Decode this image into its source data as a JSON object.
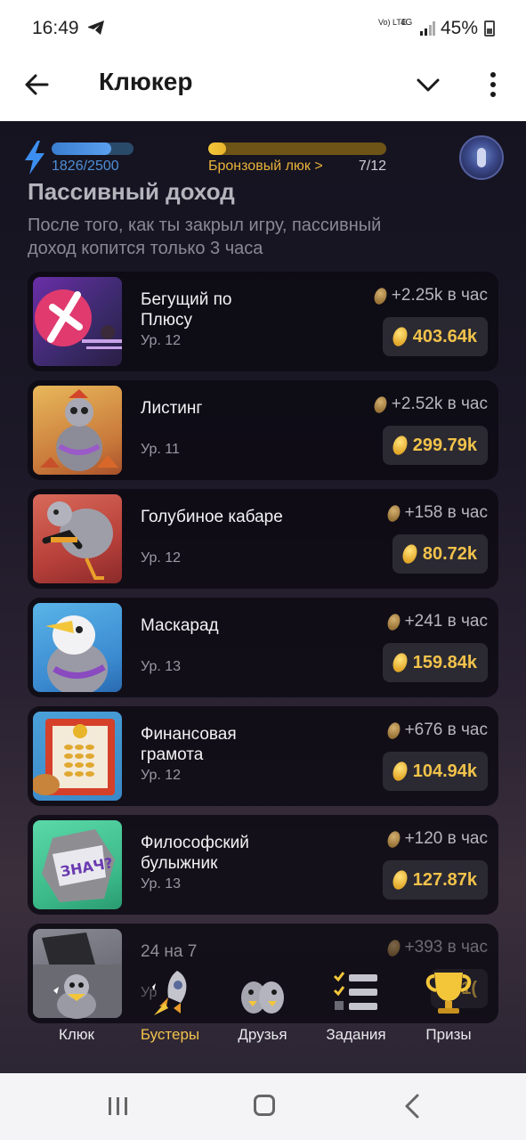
{
  "status_bar": {
    "time": "16:49",
    "network_label": "Vo) LTE",
    "network_type": "4G",
    "battery": "45%"
  },
  "app_bar": {
    "title": "Клюкер"
  },
  "hud": {
    "energy_current": 1826,
    "energy_max": 2500,
    "energy_text": "1826/2500",
    "energy_fraction": 0.73,
    "rank_link": "Бронзовый люк >",
    "rank_progress_text": "7/12",
    "rank_fraction": 0.1
  },
  "section": {
    "title": "Пассивный доход",
    "description": "После того, как ты закрыл игру, пассивный доход копится только 3 часа"
  },
  "cards": [
    {
      "name": "Бегущий по Плюсу",
      "level": "Ур. 12",
      "rate": "+2.25k в час",
      "price": "403.64k"
    },
    {
      "name": "Листинг",
      "level": "Ур. 11",
      "rate": "+2.52k в час",
      "price": "299.79k"
    },
    {
      "name": "Голубиное кабаре",
      "level": "Ур. 12",
      "rate": "+158 в час",
      "price": "80.72k"
    },
    {
      "name": "Маскарад",
      "level": "Ур. 13",
      "rate": "+241 в час",
      "price": "159.84k"
    },
    {
      "name": "Финансовая грамота",
      "level": "Ур. 12",
      "rate": "+676 в час",
      "price": "104.94k"
    },
    {
      "name": "Философский булыжник",
      "level": "Ур. 13",
      "rate": "+120 в час",
      "price": "127.87k"
    },
    {
      "name": "24 на 7",
      "level": "Ур",
      "rate": "+393 в час",
      "price": "1("
    }
  ],
  "bottom_nav": [
    {
      "label": "Клюк",
      "icon": "pigeon-icon",
      "active": false
    },
    {
      "label": "Бустеры",
      "icon": "rocket-icon",
      "active": true
    },
    {
      "label": "Друзья",
      "icon": "friends-icon",
      "active": false
    },
    {
      "label": "Задания",
      "icon": "tasks-icon",
      "active": false
    },
    {
      "label": "Призы",
      "icon": "trophy-icon",
      "active": false
    }
  ],
  "colors": {
    "accent_gold": "#f2c24a",
    "energy_blue": "#4e8fd8",
    "background": "#1c1827"
  }
}
